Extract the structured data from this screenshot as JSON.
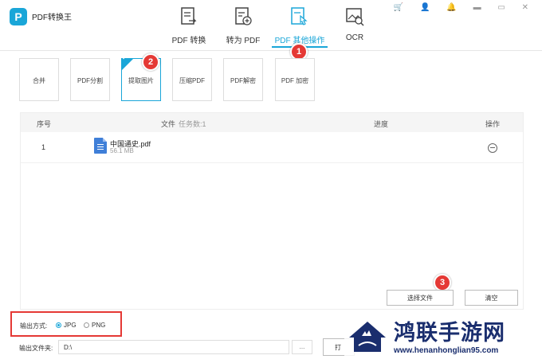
{
  "app": {
    "logo_letter": "P",
    "title": "PDF转换王",
    "window_controls": "🛒 👤 🔔 ▬ ▭ ✕"
  },
  "nav": [
    {
      "label": "PDF 转换",
      "icon": "document-convert-icon"
    },
    {
      "label": "转为 PDF",
      "icon": "document-add-icon"
    },
    {
      "label": "PDF 其他操作",
      "icon": "document-touch-icon",
      "active": true
    },
    {
      "label": "OCR",
      "icon": "image-search-icon"
    }
  ],
  "tools": [
    "合并",
    "PDF分割",
    "提取图片",
    "压缩PDF",
    "PDF解密",
    "PDF 加密"
  ],
  "active_tool": "提取图片",
  "steps": [
    "1",
    "2",
    "3"
  ],
  "table": {
    "headers": {
      "index": "序号",
      "file": "文件",
      "task_count": "任务数:1",
      "progress": "进度",
      "action": "操作"
    },
    "rows": [
      {
        "index": "1",
        "name": "中国通史.pdf",
        "size": "56.1 MB"
      }
    ]
  },
  "buttons": {
    "select_file": "选择文件",
    "clear": "清空",
    "open": "打"
  },
  "output": {
    "label": "输出方式:",
    "options": [
      "JPG",
      "PNG"
    ],
    "selected": "JPG",
    "folder_label": "输出文件夹:",
    "folder_value": "D:\\",
    "browse": "..."
  },
  "watermark": {
    "name": "鸿联手游网",
    "url": "www.henanhonglian95.com"
  },
  "colors": {
    "accent": "#1aa6d8",
    "marker": "#e53935",
    "watermark": "#1a2e6e"
  }
}
